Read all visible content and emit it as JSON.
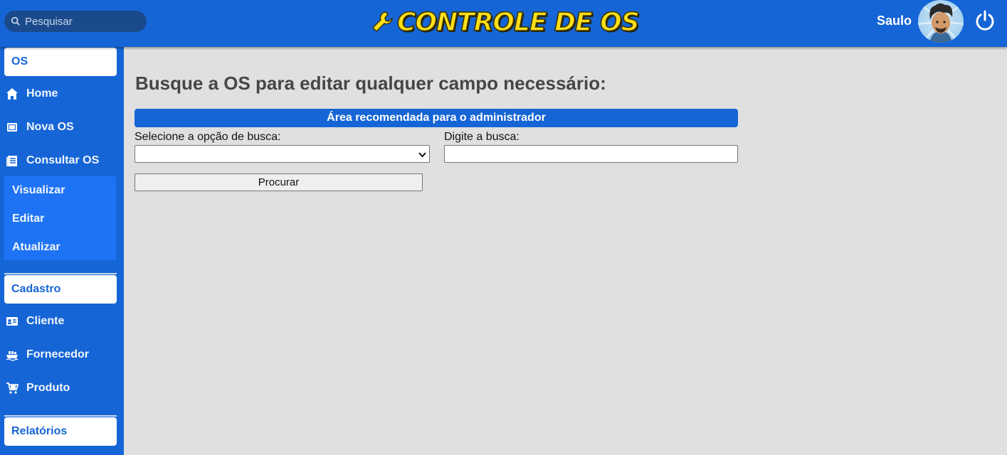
{
  "header": {
    "search_placeholder": "Pesquisar",
    "logo_text": "Controle de OS",
    "user_name": "Saulo"
  },
  "sidebar": {
    "os_header": "OS",
    "os_items": [
      {
        "label": "Home",
        "icon": "home-icon"
      },
      {
        "label": "Nova OS",
        "icon": "new-document-icon"
      },
      {
        "label": "Consultar OS",
        "icon": "list-icon"
      }
    ],
    "consultar_submenu": [
      "Visualizar",
      "Editar",
      "Atualizar"
    ],
    "cadastro_header": "Cadastro",
    "cadastro_items": [
      {
        "label": "Cliente",
        "icon": "id-card-icon"
      },
      {
        "label": "Fornecedor",
        "icon": "ship-icon"
      },
      {
        "label": "Produto",
        "icon": "cart-icon"
      }
    ],
    "relatorios_header": "Relatórios"
  },
  "main": {
    "title": "Busque a OS para editar qualquer campo necessário:",
    "admin_banner": "Área recomendada para o administrador",
    "select_label": "Selecione a opção de busca:",
    "select_value": "",
    "input_label": "Digite a busca:",
    "input_value": "",
    "search_button": "Procurar"
  },
  "colors": {
    "primary": "#1565d6",
    "submenu": "#1e73f5",
    "background": "#e0e0e0",
    "logo_yellow": "#ffdf1a"
  }
}
